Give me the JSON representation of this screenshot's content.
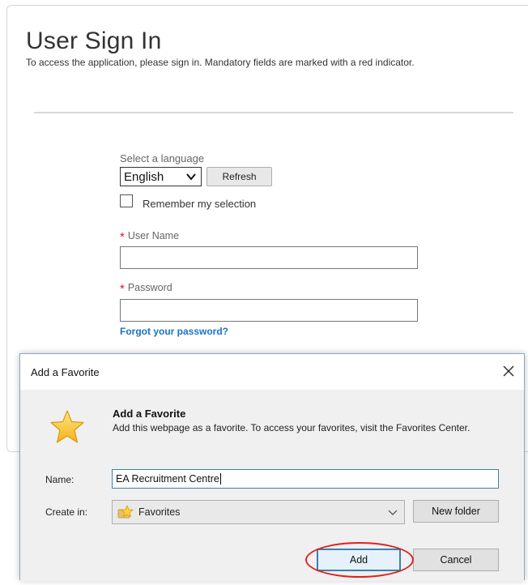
{
  "signin": {
    "title": "User Sign In",
    "intro": "To access the application, please sign in. Mandatory fields are marked with a red indicator.",
    "language_label": "Select a language",
    "language_value": "English",
    "refresh_label": "Refresh",
    "remember_label": "Remember my selection",
    "remember_checked": false,
    "required_marker": "*",
    "username_label": "User Name",
    "username_value": "",
    "password_label": "Password",
    "password_value": "",
    "forgot_label": "Forgot your password?"
  },
  "dialog": {
    "window_title": "Add a Favorite",
    "close_glyph": "✕",
    "heading": "Add a Favorite",
    "description": "Add this webpage as a favorite. To access your favorites, visit the Favorites Center.",
    "name_label": "Name:",
    "name_value": "EA Recruitment Centre",
    "create_in_label": "Create in:",
    "create_in_value": "Favorites",
    "new_folder_label": "New folder",
    "add_label": "Add",
    "cancel_label": "Cancel"
  },
  "colors": {
    "required": "#d81b1b",
    "link": "#1a73c8",
    "highlight_ellipse": "#e02020",
    "dialog_border": "#8ea6c4",
    "focus_border": "#3c7fb1"
  },
  "icons": {
    "dialog_star": "star-icon",
    "folder_star": "favorites-star-icon",
    "dropdown": "chevron-down-icon",
    "close": "close-icon"
  }
}
